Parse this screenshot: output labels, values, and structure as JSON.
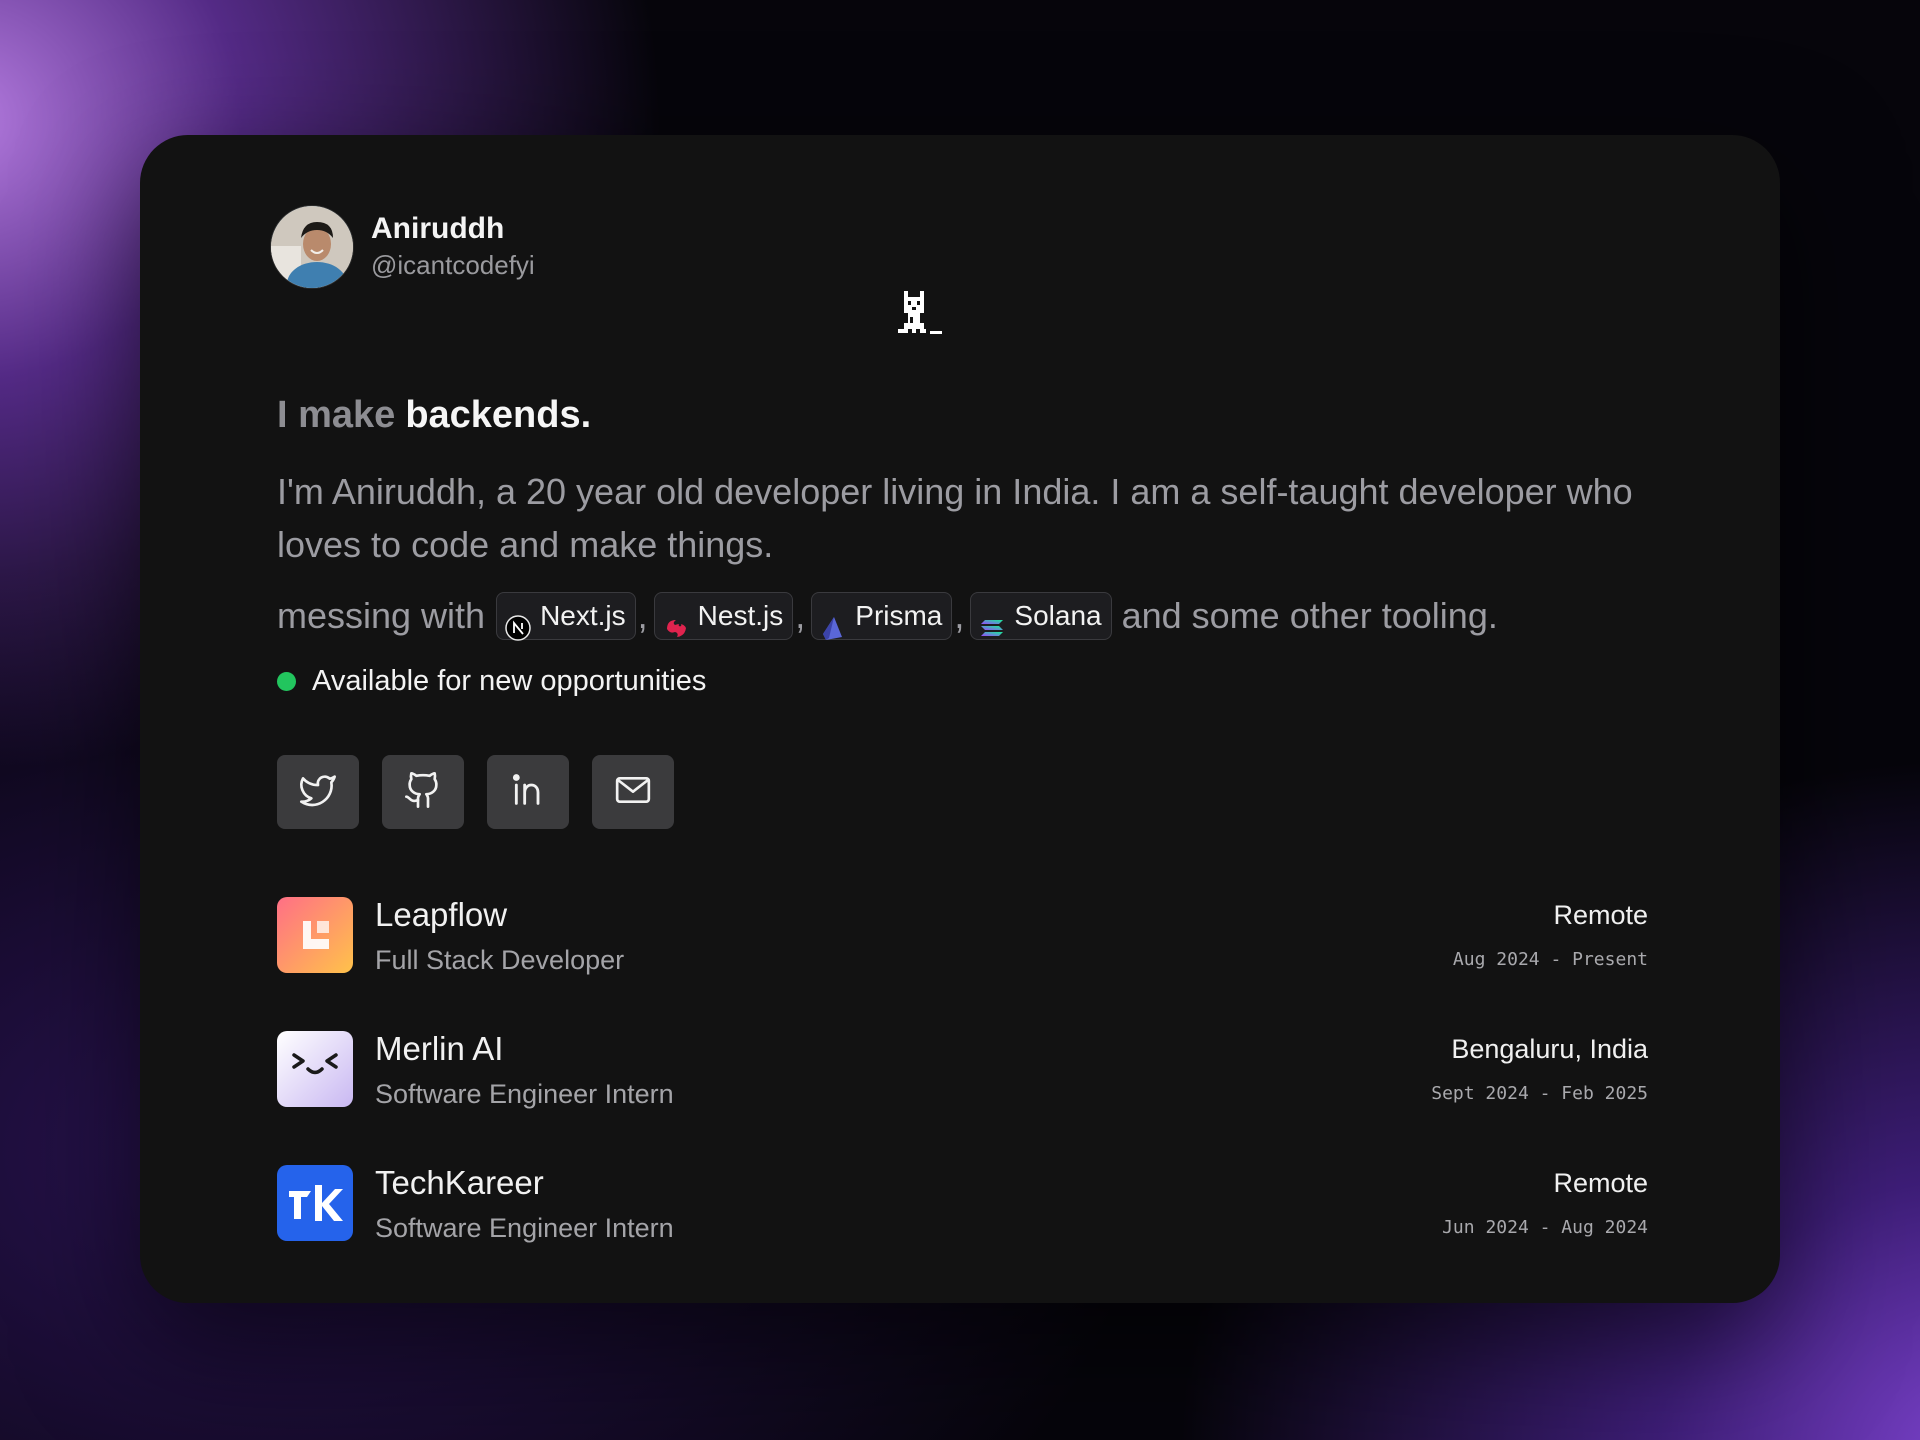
{
  "profile": {
    "name": "Aniruddh",
    "handle": "@icantcodefyi"
  },
  "headline": {
    "prefix": "I make",
    "emphasis": "backends."
  },
  "bio": "I'm Aniruddh, a 20 year old developer living in India. I am a self-taught developer who loves to code and make things.",
  "stack": {
    "prefix": "messing with",
    "tools": [
      {
        "label": "Next.js",
        "icon": "nextjs-icon"
      },
      {
        "label": "Nest.js",
        "icon": "nestjs-icon"
      },
      {
        "label": "Prisma",
        "icon": "prisma-icon"
      },
      {
        "label": "Solana",
        "icon": "solana-icon"
      }
    ],
    "separator": ",",
    "suffix": "and some other tooling."
  },
  "availability": {
    "text": "Available for new opportunities",
    "color": "#22c55e"
  },
  "socials": [
    "twitter-icon",
    "github-icon",
    "linkedin-icon",
    "mail-icon"
  ],
  "experience": [
    {
      "company": "Leapflow",
      "role": "Full Stack Developer",
      "location": "Remote",
      "dates": "Aug 2024 - Present"
    },
    {
      "company": "Merlin AI",
      "role": "Software Engineer Intern",
      "location": "Bengaluru, India",
      "dates": "Sept 2024 - Feb 2025"
    },
    {
      "company": "TechKareer",
      "role": "Software Engineer Intern",
      "location": "Remote",
      "dates": "Jun 2024 - Aug 2024"
    }
  ],
  "colors": {
    "card": "#121212",
    "accent_green": "#22c55e",
    "button": "#3b3b3d"
  }
}
